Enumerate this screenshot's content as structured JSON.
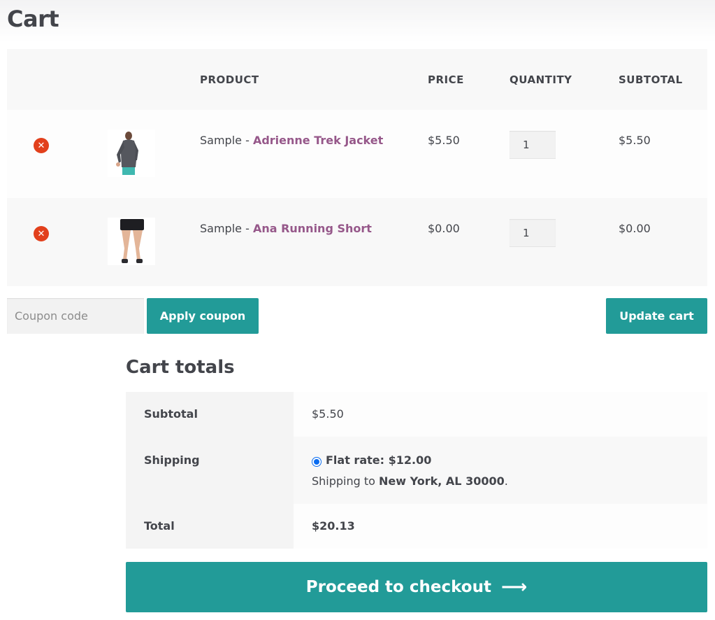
{
  "page": {
    "title": "Cart"
  },
  "table": {
    "headers": {
      "product": "PRODUCT",
      "price": "PRICE",
      "quantity": "QUANTITY",
      "subtotal": "SUBTOTAL"
    },
    "rows": [
      {
        "prefix": "Sample - ",
        "name": "Adrienne Trek Jacket",
        "price": "$5.50",
        "qty": "1",
        "subtotal": "$5.50"
      },
      {
        "prefix": "Sample - ",
        "name": "Ana Running Short",
        "price": "$0.00",
        "qty": "1",
        "subtotal": "$0.00"
      }
    ]
  },
  "actions": {
    "coupon_placeholder": "Coupon code",
    "apply_label": "Apply coupon",
    "update_label": "Update cart"
  },
  "totals": {
    "title": "Cart totals",
    "subtotal_label": "Subtotal",
    "subtotal_value": "$5.50",
    "shipping_label": "Shipping",
    "shipping_option": "Flat rate: $12.00",
    "shipping_to_prefix": "Shipping to ",
    "shipping_to_place": "New York, AL 30000",
    "shipping_to_suffix": ".",
    "total_label": "Total",
    "total_value": "$20.13"
  },
  "checkout": {
    "label": "Proceed to checkout",
    "arrow": "⟶"
  },
  "colors": {
    "accent": "#229b98",
    "link": "#96588a",
    "remove": "#e2401c"
  }
}
